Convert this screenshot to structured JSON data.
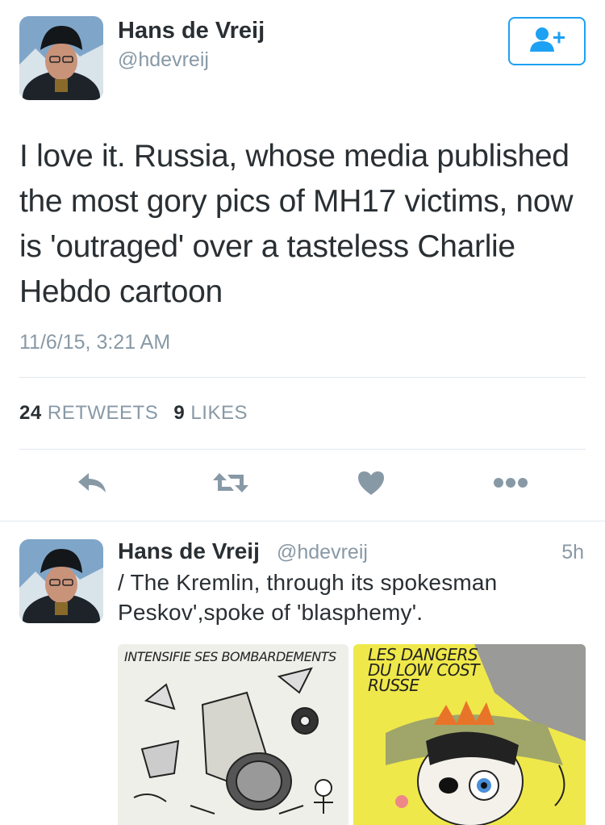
{
  "tweet": {
    "author_name": "Hans de Vreij",
    "author_handle": "@hdevreij",
    "text": "I love it. Russia, whose media published the most gory pics of MH17 victims, now is 'outraged' over a tasteless Charlie Hebdo cartoon",
    "timestamp": "11/6/15, 3:21 AM",
    "retweets_count": "24",
    "retweets_label": "RETWEETS",
    "likes_count": "9",
    "likes_label": "LIKES",
    "follow_icon": "person-add-icon"
  },
  "actions": [
    {
      "name": "reply",
      "icon": "reply-icon"
    },
    {
      "name": "retweet",
      "icon": "retweet-icon"
    },
    {
      "name": "like",
      "icon": "heart-icon"
    },
    {
      "name": "more",
      "icon": "more-dots-icon"
    }
  ],
  "reply": {
    "author_name": "Hans de Vreij",
    "author_handle": "@hdevreij",
    "time": "5h",
    "text": "/ The Kremlin, through its spokesman Peskov',spoke of 'blasphemy'.",
    "media": [
      {
        "caption": "INTENSIFIE SES BOMBARDEMENTS"
      },
      {
        "caption_lines": [
          "LES DANGERS",
          "DU LOW COST",
          "RUSSE"
        ]
      }
    ]
  },
  "colors": {
    "accent": "#1da1f2",
    "text": "#292f33",
    "muted": "#8899a6",
    "icon": "#8899a6",
    "divider": "#e1e8ed"
  }
}
